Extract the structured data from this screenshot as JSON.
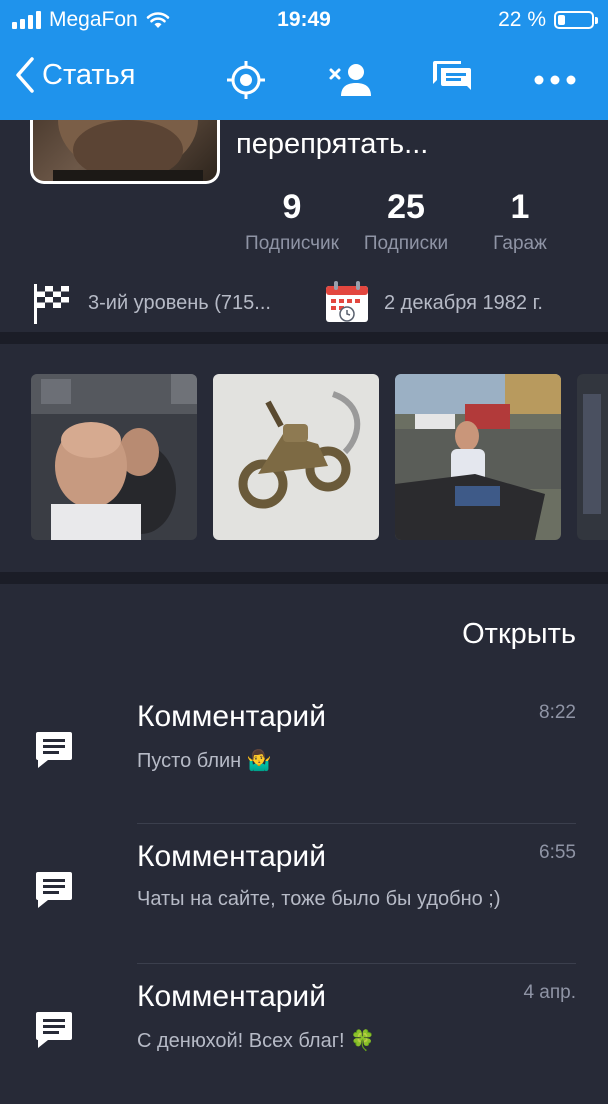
{
  "status_bar": {
    "carrier": "MegaFon",
    "time": "19:49",
    "battery_text": "22 %",
    "battery_level": 0.22
  },
  "nav": {
    "back_label": "Статья",
    "icons": [
      "target-icon",
      "remove-user-icon",
      "chat-icon",
      "more-icon"
    ]
  },
  "profile": {
    "name_fragment": "перепрятать...",
    "stats": [
      {
        "value": "9",
        "label": "Подписчик"
      },
      {
        "value": "25",
        "label": "Подписки"
      },
      {
        "value": "1",
        "label": "Гараж"
      }
    ],
    "level": "3-ий уровень (715...",
    "birthdate": "2 декабря 1982 г."
  },
  "photos": [
    "selfie-night-photo",
    "motorcycle-keychain-photo",
    "man-on-motorcycle-photo",
    "dark-photo-partial"
  ],
  "feed": {
    "open_label": "Открыть",
    "items": [
      {
        "title": "Комментарий",
        "time": "8:22",
        "text": "Пусто блин 🤷‍♂️"
      },
      {
        "title": "Комментарий",
        "time": "6:55",
        "text": "Чаты на сайте, тоже было бы удобно ;)"
      },
      {
        "title": "Комментарий",
        "time": "4 апр.",
        "text": "С денюхой! Всех благ! 🍀"
      }
    ]
  },
  "colors": {
    "header_blue": "#1f93ec",
    "background": "#272a37",
    "band": "#1b1d27",
    "muted_text": "#8f94a5"
  }
}
